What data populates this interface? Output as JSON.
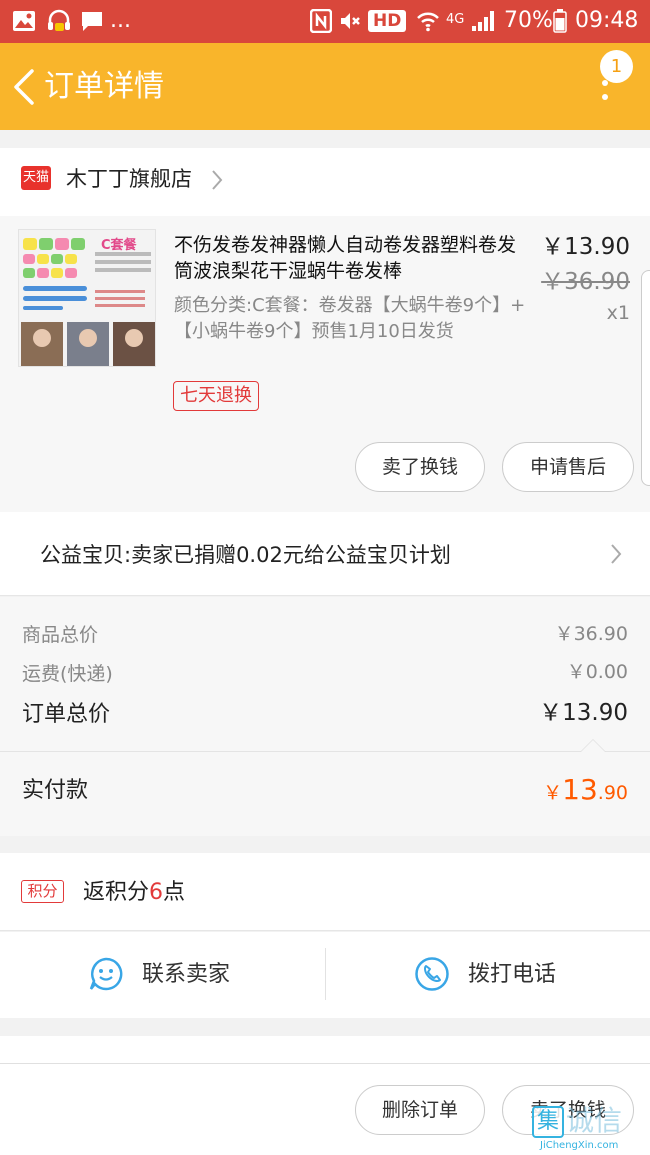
{
  "status_bar": {
    "hd": "HD",
    "network": "4G",
    "battery": "70%",
    "time": "09:48",
    "more": "..."
  },
  "header": {
    "title": "订单详情",
    "notification_count": "1"
  },
  "shop": {
    "badge": "天猫",
    "name": "木丁丁旗舰店"
  },
  "product": {
    "title": "不伤发卷发神器懒人自动卷发器塑料卷发筒波浪梨花干湿蜗牛卷发棒",
    "spec": "颜色分类:C套餐：卷发器【大蜗牛卷9个】+【小蜗牛卷9个】预售1月10日发货",
    "tag": "七天退换",
    "price": "￥13.90",
    "original_price": "￥36.90",
    "quantity": "x1",
    "thumb_label": "C套餐",
    "actions": [
      "卖了换钱",
      "申请售后"
    ]
  },
  "charity": {
    "text": "公益宝贝:卖家已捐赠0.02元给公益宝贝计划"
  },
  "totals": {
    "goods_label": "商品总价",
    "goods_value": "￥36.90",
    "shipping_label": "运费(快递)",
    "shipping_value": "￥0.00",
    "order_label": "订单总价",
    "order_value": "￥13.90"
  },
  "paid": {
    "label": "实付款",
    "currency": "￥",
    "integer": "13",
    "decimal": ".90"
  },
  "points": {
    "badge": "积分",
    "prefix": "返积分",
    "number": "6",
    "suffix": "点"
  },
  "contact": {
    "seller": "联系卖家",
    "phone": "拨打电话"
  },
  "bottom": {
    "delete": "删除订单",
    "sell": "卖了换钱"
  },
  "watermark": {
    "mark": "集",
    "text": "诚信",
    "url": "JiChengXin.com"
  },
  "colors": {
    "status_bar": "#d9473b",
    "header": "#f9b52b",
    "price_accent": "#ff5a00",
    "tag_red": "#e23a3a"
  }
}
